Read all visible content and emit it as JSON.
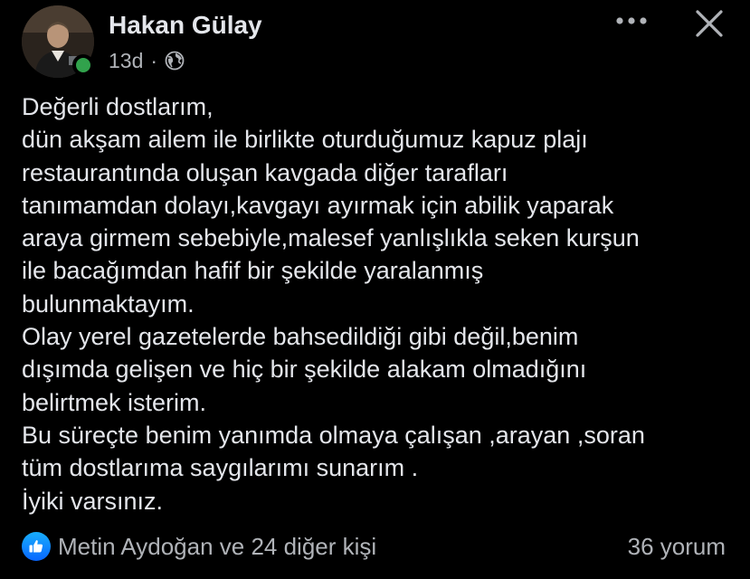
{
  "post": {
    "author": "Hakan Gülay",
    "time": "13d",
    "separator": "·",
    "privacy_icon": "globe-icon",
    "online_color": "#31a24c",
    "body_lines": [
      "Değerli dostlarım,",
      "dün akşam ailem ile birlikte oturduğumuz kapuz plajı",
      "restaurantında oluşan kavgada diğer tarafları",
      "tanımamdan dolayı,kavgayı ayırmak için abilik yaparak",
      "araya girmem sebebiyle,malesef yanlışlıkla seken kurşun",
      "ile bacağımdan hafif bir şekilde yaralanmış",
      "bulunmaktayım.",
      "Olay yerel gazetelerde bahsedildiği gibi değil,benim",
      "dışımda gelişen ve hiç bir şekilde alakam olmadığını",
      "belirtmek isterim.",
      "Bu süreçte benim yanımda olmaya çalışan ,arayan ,soran",
      "tüm dostlarıma saygılarımı sunarım .",
      "İyiki varsınız."
    ]
  },
  "header_actions": {
    "more_icon": "more-horizontal-icon",
    "close_icon": "close-icon"
  },
  "footer": {
    "reaction_icon": "like-icon",
    "reaction_color": "#0866ff",
    "reactions_label": "Metin Aydoğan ve 24 diğer kişi",
    "comments_label": "36 yorum"
  }
}
